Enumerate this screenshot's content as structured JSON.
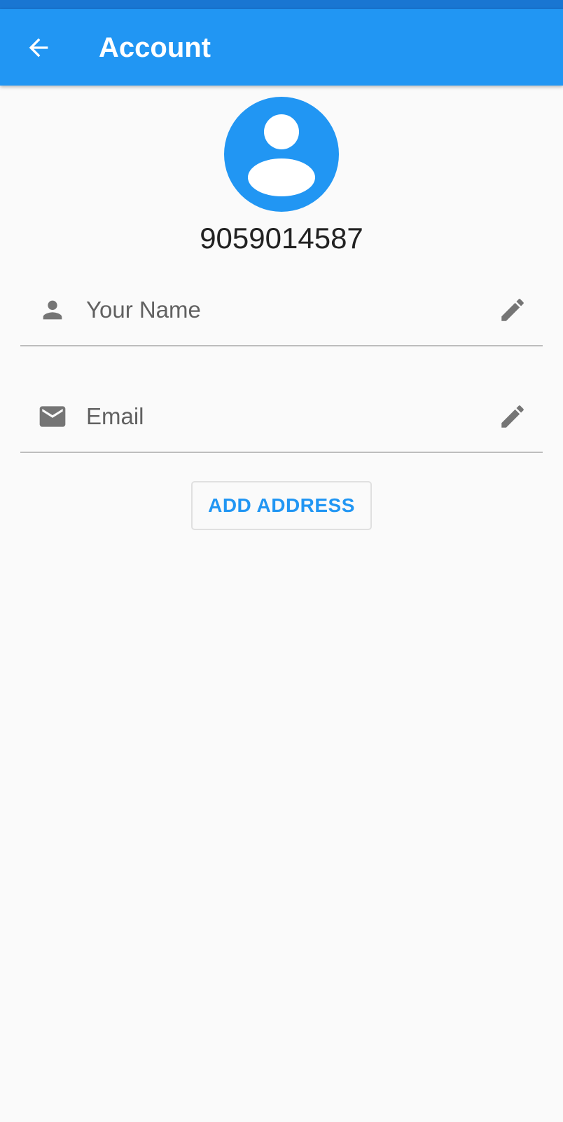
{
  "header": {
    "title": "Account",
    "back_icon": "arrow-left-icon"
  },
  "profile": {
    "avatar_icon": "account-circle-icon",
    "phone": "9059014587"
  },
  "fields": {
    "name": {
      "placeholder": "Your Name",
      "icon": "person-icon",
      "edit_icon": "pencil-icon"
    },
    "email": {
      "placeholder": "Email",
      "icon": "mail-icon",
      "edit_icon": "pencil-icon"
    }
  },
  "actions": {
    "add_address_label": "ADD ADDRESS"
  },
  "colors": {
    "primary": "#2196f3",
    "status_bar": "#1976d2",
    "background": "#fafafa",
    "icon_grey": "#757575",
    "divider": "#bdbdbd"
  }
}
